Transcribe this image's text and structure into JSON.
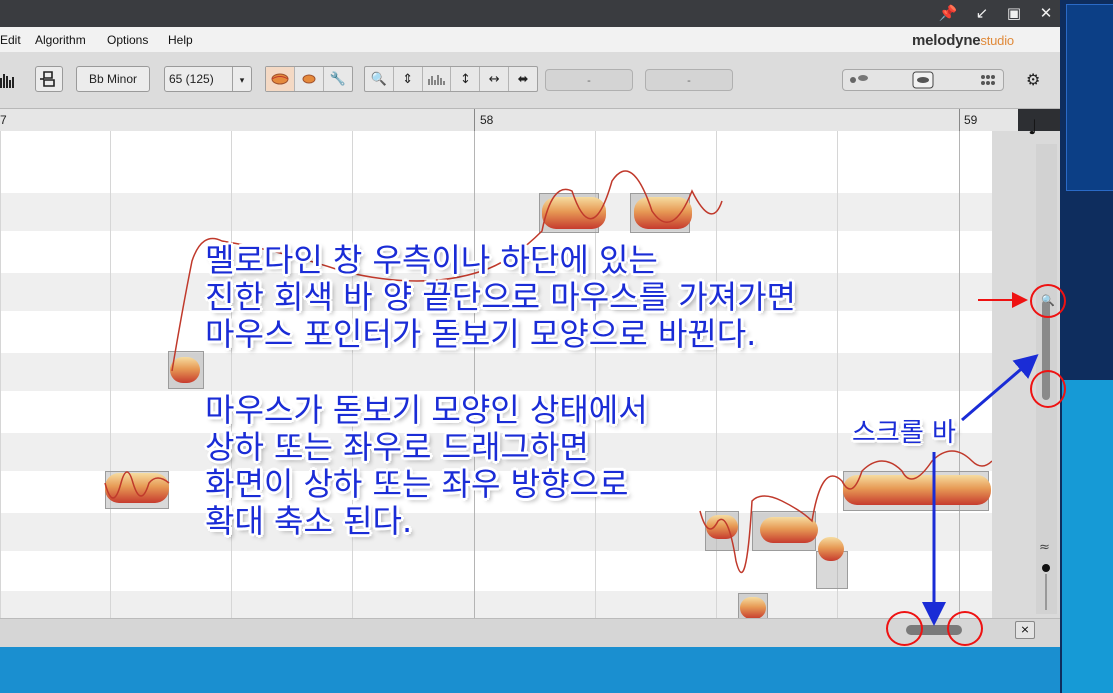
{
  "window": {
    "controls": [
      "pin-icon",
      "restore-icon",
      "maximize-icon",
      "close-icon"
    ]
  },
  "menu": {
    "items": [
      "Edit",
      "Algorithm",
      "Options",
      "Help"
    ]
  },
  "brand": {
    "name": "melodyne",
    "edition": "studio"
  },
  "toolbar": {
    "scale": "Bb Minor",
    "tempo": "65 (125)",
    "field1": "-",
    "field2": "-",
    "tools": [
      "main-tool-icon",
      "pitch-tool-icon",
      "amplitude-tool-icon",
      "time-tool-icon",
      "formant-tool-icon",
      "note-separation-icon"
    ]
  },
  "ruler": {
    "bars": [
      "7",
      "58",
      "59"
    ]
  },
  "side_panel": {
    "icons": [
      "note-value-icon",
      "chord-icon",
      "scale-icon",
      "zoom-icon",
      "vibrato-icon"
    ]
  },
  "annotations": {
    "paragraph1": [
      "멜로다인 창 우측이나 하단에 있는",
      "진한 회색 바 양 끝단으로 마우스를 가져가면",
      "마우스 포인터가 돋보기 모양으로 바뀐다."
    ],
    "paragraph2": [
      "마우스가 돋보기 모양인 상태에서",
      "상하 또는 좌우로 드래그하면",
      "화면이 상하 또는 좌우 방향으로",
      "확대 축소 된다."
    ],
    "scrollbar_label": "스크롤 바"
  },
  "colors": {
    "annotation": "#1a2cd6",
    "highlight": "#ee1212",
    "arrow_red": "#ee1212",
    "arrow_blue": "#1a2cd6"
  }
}
